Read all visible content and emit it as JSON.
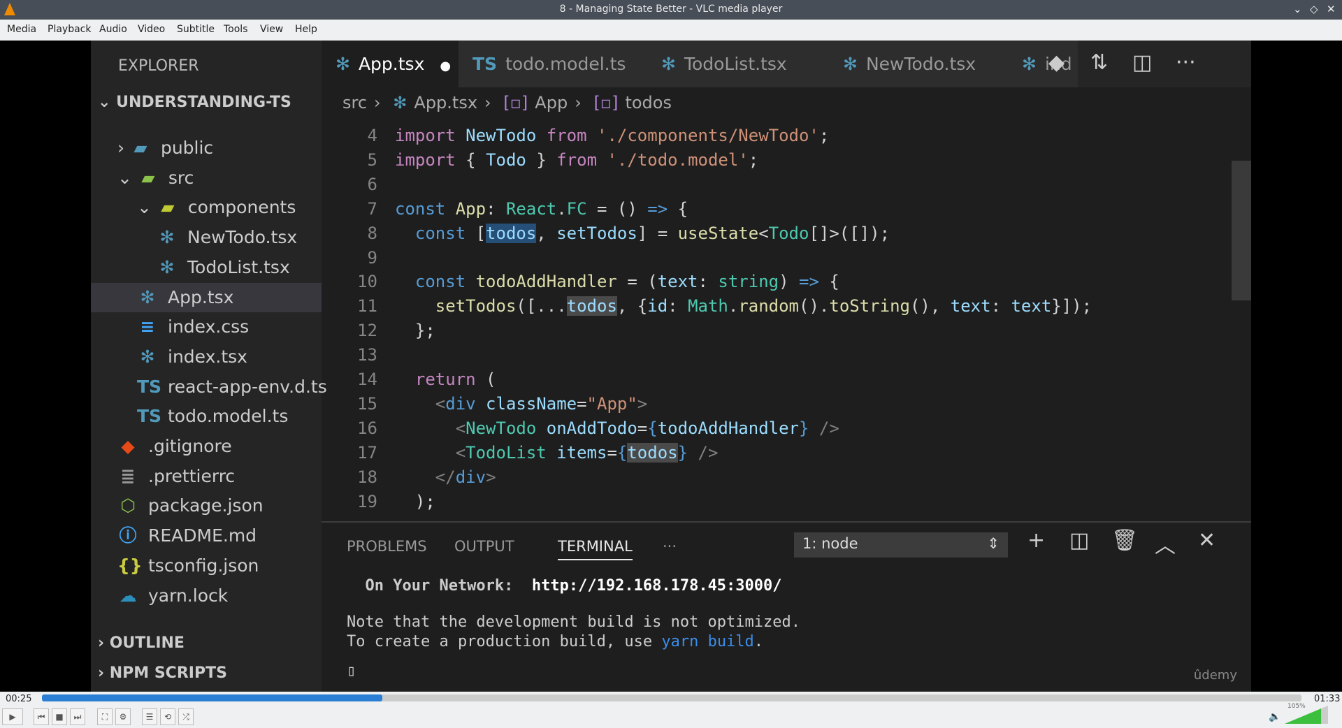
{
  "window": {
    "title": "8 - Managing State Better - VLC media player",
    "minimize": "⌄",
    "maximize": "◇",
    "close": "✕"
  },
  "menu": [
    "Media",
    "Playback",
    "Audio",
    "Video",
    "Subtitle",
    "Tools",
    "View",
    "Help"
  ],
  "explorer": {
    "header": "EXPLORER",
    "root": "UNDERSTANDING-TS",
    "outline": "OUTLINE",
    "npm": "NPM SCRIPTS",
    "items": [
      {
        "label": "public",
        "icon": "folder-icon",
        "glyph": "▰",
        "color": "#519aba",
        "indent": 1,
        "chev": "›"
      },
      {
        "label": "src",
        "icon": "folder-src-icon",
        "glyph": "▰",
        "color": "#8bc34a",
        "indent": 1,
        "chev": "⌄"
      },
      {
        "label": "components",
        "icon": "folder-components-icon",
        "glyph": "▰",
        "color": "#c0ca33",
        "indent": 2,
        "chev": "⌄"
      },
      {
        "label": "NewTodo.tsx",
        "icon": "react-icon",
        "glyph": "✻",
        "color": "#519aba",
        "indent": 3
      },
      {
        "label": "TodoList.tsx",
        "icon": "react-icon",
        "glyph": "✻",
        "color": "#519aba",
        "indent": 3
      },
      {
        "label": "App.tsx",
        "icon": "react-icon",
        "glyph": "✻",
        "color": "#519aba",
        "indent": 2,
        "selected": true
      },
      {
        "label": "index.css",
        "icon": "css-icon",
        "glyph": "≡",
        "color": "#42a5f5",
        "indent": 2
      },
      {
        "label": "index.tsx",
        "icon": "react-icon",
        "glyph": "✻",
        "color": "#519aba",
        "indent": 2
      },
      {
        "label": "react-app-env.d.ts",
        "icon": "ts-icon",
        "glyph": "TS",
        "color": "#519aba",
        "indent": 2
      },
      {
        "label": "todo.model.ts",
        "icon": "ts-icon",
        "glyph": "TS",
        "color": "#519aba",
        "indent": 2
      },
      {
        "label": ".gitignore",
        "icon": "git-icon",
        "glyph": "◆",
        "color": "#e64a19",
        "indent": 1
      },
      {
        "label": ".prettierrc",
        "icon": "prettier-icon",
        "glyph": "≣",
        "color": "#999",
        "indent": 1
      },
      {
        "label": "package.json",
        "icon": "npm-icon",
        "glyph": "⬡",
        "color": "#8bc34a",
        "indent": 1
      },
      {
        "label": "README.md",
        "icon": "info-icon",
        "glyph": "ⓘ",
        "color": "#42a5f5",
        "indent": 1
      },
      {
        "label": "tsconfig.json",
        "icon": "json-icon",
        "glyph": "{}",
        "color": "#cbcb41",
        "indent": 1
      },
      {
        "label": "yarn.lock",
        "icon": "yarn-icon",
        "glyph": "☁",
        "color": "#2c8ebb",
        "indent": 1
      }
    ]
  },
  "tabs": [
    {
      "label": "App.tsx",
      "icon": "react-icon",
      "active": true,
      "dirty": "●"
    },
    {
      "label": "todo.model.ts",
      "icon": "ts-icon"
    },
    {
      "label": "TodoList.tsx",
      "icon": "react-icon"
    },
    {
      "label": "NewTodo.tsx",
      "icon": "react-icon"
    },
    {
      "label": "ind",
      "icon": "react-icon"
    }
  ],
  "breadcrumb": [
    "src",
    "App.tsx",
    "App",
    "todos"
  ],
  "code": [
    {
      "n": "4",
      "t": [
        [
          "kc",
          "import "
        ],
        [
          "vr",
          "NewTodo "
        ],
        [
          "kc",
          "from "
        ],
        [
          "str",
          "'./components/NewTodo'"
        ],
        [
          "pl",
          ";"
        ]
      ]
    },
    {
      "n": "5",
      "t": [
        [
          "kc",
          "import "
        ],
        [
          "pl",
          "{ "
        ],
        [
          "vr",
          "Todo "
        ],
        [
          "pl",
          "} "
        ],
        [
          "kc",
          "from "
        ],
        [
          "str",
          "'./todo.model'"
        ],
        [
          "pl",
          ";"
        ]
      ]
    },
    {
      "n": "6",
      "t": []
    },
    {
      "n": "7",
      "t": [
        [
          "kw",
          "const "
        ],
        [
          "fn",
          "App"
        ],
        [
          "pl",
          ": "
        ],
        [
          "ty",
          "React"
        ],
        [
          "pl",
          "."
        ],
        [
          "ty",
          "FC"
        ],
        [
          "pl",
          " = () "
        ],
        [
          "kw",
          "=>"
        ],
        [
          "pl",
          " {"
        ]
      ]
    },
    {
      "n": "8",
      "t": [
        [
          "kw",
          "  const "
        ],
        [
          "pl",
          "["
        ],
        [
          "vr hl",
          "todos"
        ],
        [
          "pl",
          ", "
        ],
        [
          "vr",
          "setTodos"
        ],
        [
          "pl",
          "] = "
        ],
        [
          "fn",
          "useState"
        ],
        [
          "pl",
          "<"
        ],
        [
          "ty",
          "Todo"
        ],
        [
          "pl",
          "[]>([]);"
        ]
      ]
    },
    {
      "n": "9",
      "t": []
    },
    {
      "n": "10",
      "t": [
        [
          "kw",
          "  const "
        ],
        [
          "fn",
          "todoAddHandler"
        ],
        [
          "pl",
          " = ("
        ],
        [
          "vr",
          "text"
        ],
        [
          "pl",
          ": "
        ],
        [
          "ty",
          "string"
        ],
        [
          "pl",
          ") "
        ],
        [
          "kw",
          "=>"
        ],
        [
          "pl",
          " {"
        ]
      ]
    },
    {
      "n": "11",
      "t": [
        [
          "fn",
          "    setTodos"
        ],
        [
          "pl",
          "([..."
        ],
        [
          "vr hl2",
          "todos"
        ],
        [
          "pl",
          ", {"
        ],
        [
          "vr",
          "id"
        ],
        [
          "pl",
          ": "
        ],
        [
          "ty",
          "Math"
        ],
        [
          "pl",
          "."
        ],
        [
          "fn",
          "random"
        ],
        [
          "pl",
          "()."
        ],
        [
          "fn",
          "toString"
        ],
        [
          "pl",
          "(), "
        ],
        [
          "vr",
          "text"
        ],
        [
          "pl",
          ": "
        ],
        [
          "vr",
          "text"
        ],
        [
          "pl",
          "}]);"
        ]
      ]
    },
    {
      "n": "12",
      "t": [
        [
          "pl",
          "  };"
        ]
      ]
    },
    {
      "n": "13",
      "t": []
    },
    {
      "n": "14",
      "t": [
        [
          "kc",
          "  return "
        ],
        [
          "pl",
          "("
        ]
      ]
    },
    {
      "n": "15",
      "t": [
        [
          "tg",
          "    <"
        ],
        [
          "kw",
          "div "
        ],
        [
          "vr",
          "className"
        ],
        [
          "pl",
          "="
        ],
        [
          "str",
          "\"App\""
        ],
        [
          "tg",
          ">"
        ]
      ]
    },
    {
      "n": "16",
      "t": [
        [
          "tg",
          "      <"
        ],
        [
          "ty",
          "NewTodo "
        ],
        [
          "vr",
          "onAddTodo"
        ],
        [
          "pl",
          "="
        ],
        [
          "kw",
          "{"
        ],
        [
          "vr",
          "todoAddHandler"
        ],
        [
          "kw",
          "}"
        ],
        [
          "tg",
          " />"
        ]
      ]
    },
    {
      "n": "17",
      "t": [
        [
          "tg",
          "      <"
        ],
        [
          "ty",
          "TodoList "
        ],
        [
          "vr",
          "items"
        ],
        [
          "pl",
          "="
        ],
        [
          "kw",
          "{"
        ],
        [
          "vr hl2",
          "todos"
        ],
        [
          "kw",
          "}"
        ],
        [
          "tg",
          " />"
        ]
      ]
    },
    {
      "n": "18",
      "t": [
        [
          "tg",
          "    </"
        ],
        [
          "kw",
          "div"
        ],
        [
          "tg",
          ">"
        ]
      ]
    },
    {
      "n": "19",
      "t": [
        [
          "pl",
          "  );"
        ]
      ]
    }
  ],
  "panel": {
    "tabs": [
      "PROBLEMS",
      "OUTPUT",
      "TERMINAL",
      "···"
    ],
    "active": 2,
    "terminal_select": "1: node",
    "lines": [
      "  On Your Network:  http://192.168.178.45:3000/",
      "Note that the development build is not optimized.",
      "To create a production build, use yarn build."
    ],
    "watermark": "ûdemy"
  },
  "player": {
    "elapsed": "00:25",
    "total": "01:33",
    "progress": 0.27,
    "volume": "105%",
    "volume_level": 1.05
  }
}
